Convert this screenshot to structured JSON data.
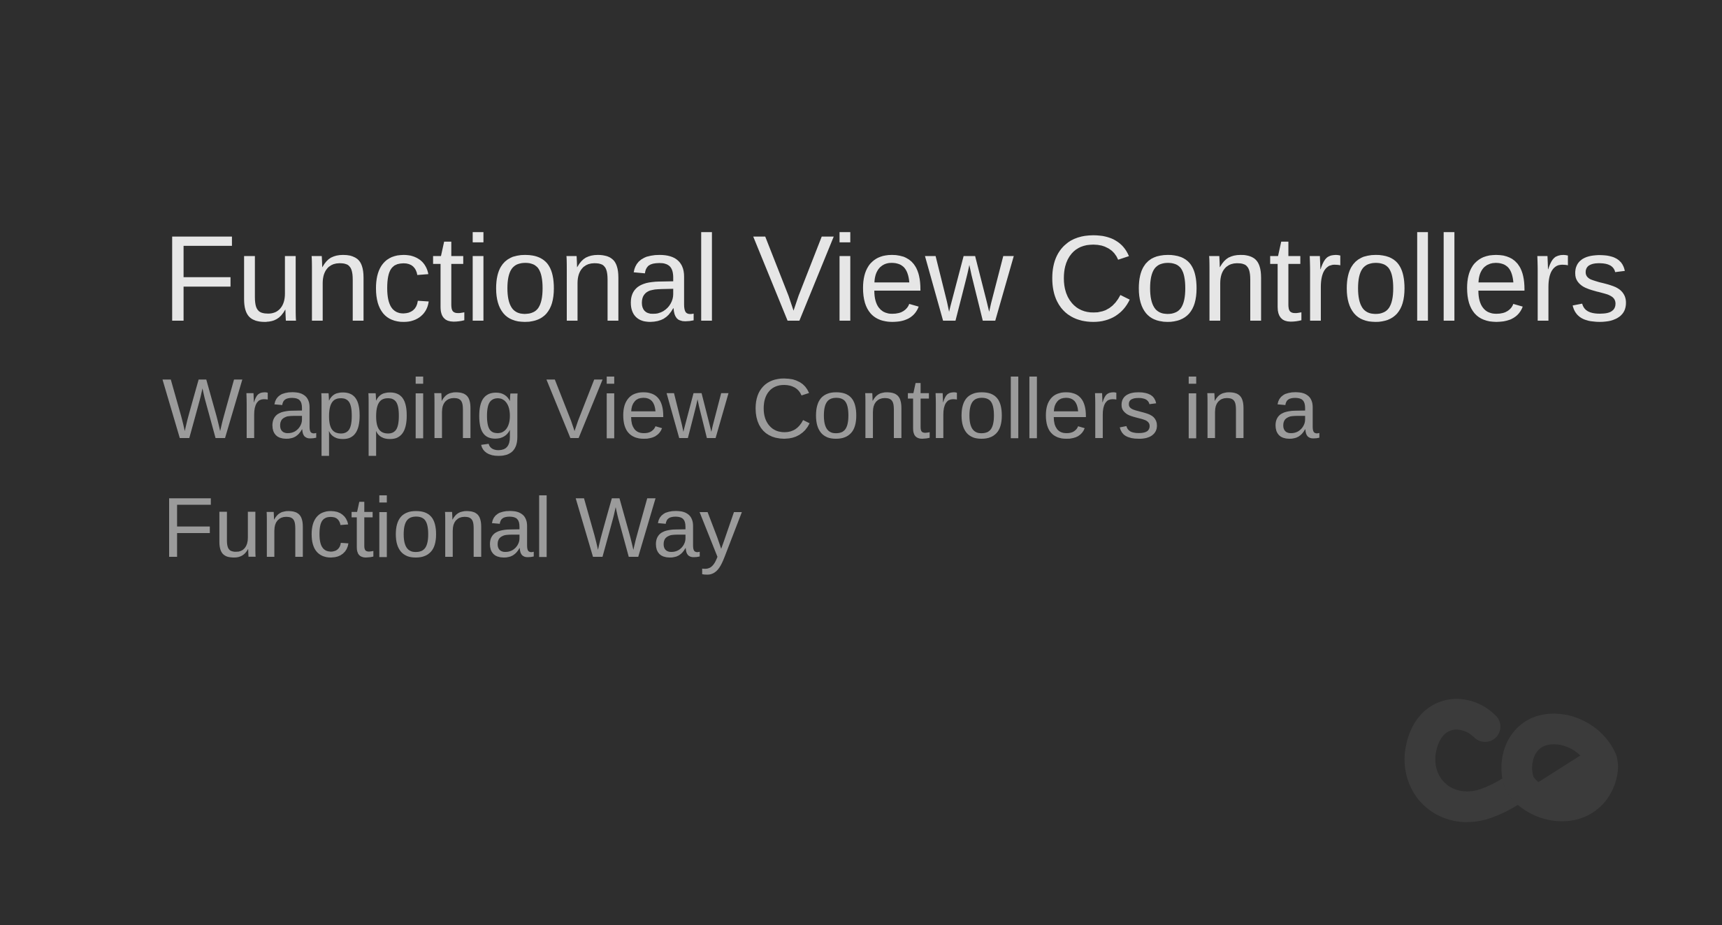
{
  "slide": {
    "title": "Functional View Controllers",
    "subtitle": "Wrapping View Controllers in a Functional Way"
  },
  "logo": {
    "name": "ce-logo",
    "color": "#3b3b3b"
  },
  "colors": {
    "background": "#2e2e2e",
    "title": "#e6e6e6",
    "subtitle": "#9b9b9b"
  }
}
